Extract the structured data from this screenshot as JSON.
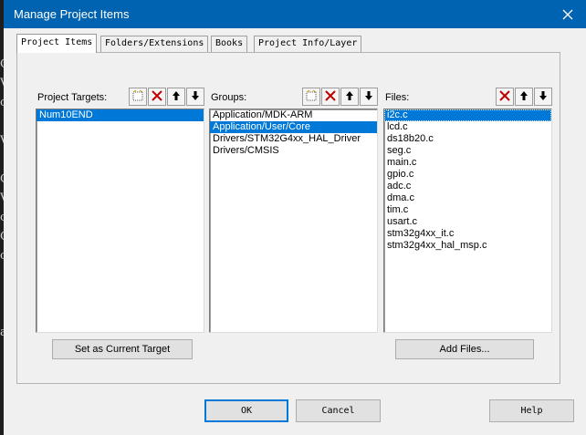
{
  "window": {
    "title": "Manage Project Items"
  },
  "background_glyphs": [
    "C",
    "V",
    "c",
    "",
    "V",
    "",
    "C",
    "V",
    "c",
    "C",
    "c",
    "",
    "",
    "",
    "a"
  ],
  "tabs": [
    {
      "label": "Project Items",
      "active": true
    },
    {
      "label": "Folders/Extensions",
      "active": false
    },
    {
      "label": "Books",
      "active": false
    },
    {
      "label": "Project Info/Layer",
      "active": false
    }
  ],
  "targets": {
    "label": "Project Targets:",
    "items": [
      "Num10END"
    ],
    "selected": 0
  },
  "groups": {
    "label": "Groups:",
    "items": [
      "Application/MDK-ARM",
      "Application/User/Core",
      "Drivers/STM32G4xx_HAL_Driver",
      "Drivers/CMSIS"
    ],
    "selected": 1
  },
  "files": {
    "label": "Files:",
    "items": [
      "i2c.c",
      "lcd.c",
      "ds18b20.c",
      "seg.c",
      "main.c",
      "gpio.c",
      "adc.c",
      "dma.c",
      "tim.c",
      "usart.c",
      "stm32g4xx_it.c",
      "stm32g4xx_hal_msp.c"
    ],
    "selected": 0
  },
  "buttons": {
    "set_current_target": "Set as Current Target",
    "add_files": "Add Files...",
    "ok": "OK",
    "cancel": "Cancel",
    "help": "Help"
  },
  "colors": {
    "titlebar": "#0063b1",
    "selection": "#0078d7",
    "delete_red": "#c00000"
  },
  "icons": {
    "new": "new-item-icon",
    "delete": "delete-x-icon",
    "up": "move-up-icon",
    "down": "move-down-icon",
    "close": "close-icon"
  }
}
